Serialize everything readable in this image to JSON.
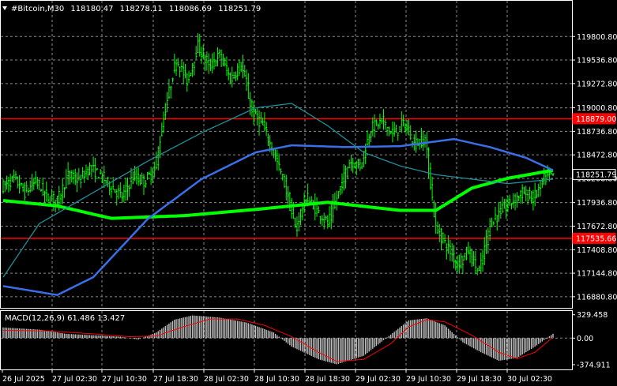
{
  "header": {
    "icon": "triangle-down-icon",
    "symbol": "#Bitcoin,M30",
    "open": "118180.47",
    "high": "118278.11",
    "low": "118086.69",
    "close": "118251.79"
  },
  "macd_label": "MACD(12,26,9) 61.486 13.427",
  "colors": {
    "background": "#000000",
    "candle": "#00ff00",
    "ma_slow": "#00ff00",
    "ma_blue": "#3a6fe8",
    "ma_teal": "#1f8f9a",
    "hline": "#ff0000",
    "macd_hist": "#c0c0c0",
    "macd_signal": "#ff0000",
    "grid": "#8a8a8a"
  },
  "chart_data": [
    {
      "type": "candlestick",
      "title": "#Bitcoin,M30",
      "ylim": [
        116800,
        120060
      ],
      "y_ticks": [
        "119800.80",
        "119536.80",
        "119272.80",
        "119000.80",
        "118736.80",
        "118472.80",
        "118208.80",
        "117936.80",
        "117672.80",
        "117408.80",
        "117144.80",
        "116880.80"
      ],
      "x_labels": [
        "26 Jul 2025",
        "27 Jul 02:30",
        "27 Jul 10:30",
        "27 Jul 18:30",
        "28 Jul 02:30",
        "28 Jul 10:30",
        "28 Jul 18:30",
        "29 Jul 02:30",
        "29 Jul 10:30",
        "29 Jul 18:30",
        "30 Jul 02:30"
      ],
      "grid": true,
      "price_tags": [
        {
          "label": "118879.00",
          "value": 118879.0,
          "type": "resistance",
          "color": "#ff0000"
        },
        {
          "label": "118251.79",
          "value": 118251.79,
          "type": "current",
          "color": "#000000"
        },
        {
          "label": "117535.66",
          "value": 117535.66,
          "type": "support",
          "color": "#ff0000"
        }
      ],
      "price_path": [
        [
          0,
          118120
        ],
        [
          6,
          118200
        ],
        [
          12,
          118050
        ],
        [
          18,
          118180
        ],
        [
          24,
          118000
        ],
        [
          30,
          117960
        ],
        [
          36,
          118240
        ],
        [
          42,
          118180
        ],
        [
          48,
          118330
        ],
        [
          54,
          118240
        ],
        [
          60,
          118110
        ],
        [
          66,
          118000
        ],
        [
          72,
          118230
        ],
        [
          78,
          118170
        ],
        [
          84,
          118300
        ],
        [
          90,
          119000
        ],
        [
          96,
          119550
        ],
        [
          102,
          119300
        ],
        [
          108,
          119700
        ],
        [
          114,
          119450
        ],
        [
          120,
          119600
        ],
        [
          126,
          119320
        ],
        [
          132,
          119500
        ],
        [
          138,
          118950
        ],
        [
          144,
          118800
        ],
        [
          150,
          118500
        ],
        [
          156,
          118150
        ],
        [
          162,
          117650
        ],
        [
          168,
          118000
        ],
        [
          174,
          117850
        ],
        [
          180,
          117700
        ],
        [
          186,
          118050
        ],
        [
          192,
          118400
        ],
        [
          198,
          118350
        ],
        [
          204,
          118780
        ],
        [
          210,
          118850
        ],
        [
          216,
          118700
        ],
        [
          222,
          118830
        ],
        [
          228,
          118600
        ],
        [
          234,
          118650
        ],
        [
          240,
          117650
        ],
        [
          246,
          117450
        ],
        [
          252,
          117250
        ],
        [
          258,
          117400
        ],
        [
          264,
          117150
        ],
        [
          270,
          117700
        ],
        [
          276,
          117850
        ],
        [
          282,
          117950
        ],
        [
          288,
          118050
        ],
        [
          294,
          117980
        ],
        [
          300,
          118200
        ],
        [
          305,
          118251.79
        ]
      ],
      "series": [
        {
          "name": "",
          "color": "#00ff00",
          "points": [
            [
              0,
              117960
            ],
            [
              30,
              117900
            ],
            [
              60,
              117760
            ],
            [
              100,
              117790
            ],
            [
              140,
              117860
            ],
            [
              180,
              117940
            ],
            [
              220,
              117850
            ],
            [
              240,
              117850
            ],
            [
              260,
              118100
            ],
            [
              280,
              118210
            ],
            [
              305,
              118300
            ]
          ]
        },
        {
          "name": "",
          "color": "#3a6fe8",
          "points": [
            [
              0,
              117000
            ],
            [
              30,
              116900
            ],
            [
              50,
              117100
            ],
            [
              80,
              117750
            ],
            [
              110,
              118200
            ],
            [
              140,
              118500
            ],
            [
              160,
              118580
            ],
            [
              190,
              118560
            ],
            [
              220,
              118570
            ],
            [
              250,
              118650
            ],
            [
              270,
              118560
            ],
            [
              290,
              118440
            ],
            [
              305,
              118300
            ]
          ]
        },
        {
          "name": "",
          "color": "#1f8f9a",
          "points": [
            [
              0,
              117100
            ],
            [
              20,
              117700
            ],
            [
              50,
              118050
            ],
            [
              80,
              118400
            ],
            [
              110,
              118720
            ],
            [
              140,
              119000
            ],
            [
              160,
              119050
            ],
            [
              180,
              118800
            ],
            [
              200,
              118500
            ],
            [
              220,
              118350
            ],
            [
              240,
              118250
            ],
            [
              260,
              118200
            ],
            [
              280,
              118150
            ],
            [
              305,
              118200
            ]
          ]
        }
      ]
    },
    {
      "type": "bar",
      "title": "MACD(12,26,9) 61.486 13.427",
      "ylim": [
        -420,
        360
      ],
      "y_ticks": [
        "329.458",
        "0.00",
        "-374.911"
      ],
      "grid": true,
      "series": [
        {
          "name": "MACD",
          "color": "#c0c0c0",
          "points": [
            [
              0,
              150
            ],
            [
              20,
              120
            ],
            [
              35,
              60
            ],
            [
              50,
              40
            ],
            [
              65,
              20
            ],
            [
              75,
              -20
            ],
            [
              85,
              80
            ],
            [
              95,
              260
            ],
            [
              105,
              320
            ],
            [
              120,
              290
            ],
            [
              135,
              220
            ],
            [
              150,
              80
            ],
            [
              160,
              -120
            ],
            [
              175,
              -300
            ],
            [
              185,
              -370
            ],
            [
              200,
              -250
            ],
            [
              215,
              50
            ],
            [
              225,
              250
            ],
            [
              235,
              280
            ],
            [
              245,
              180
            ],
            [
              255,
              -60
            ],
            [
              265,
              -200
            ],
            [
              275,
              -320
            ],
            [
              285,
              -280
            ],
            [
              295,
              -120
            ],
            [
              305,
              61.486
            ]
          ]
        },
        {
          "name": "Signal",
          "color": "#ff0000",
          "points": [
            [
              0,
              110
            ],
            [
              25,
              100
            ],
            [
              50,
              60
            ],
            [
              70,
              20
            ],
            [
              85,
              30
            ],
            [
              100,
              160
            ],
            [
              115,
              270
            ],
            [
              130,
              270
            ],
            [
              145,
              180
            ],
            [
              160,
              20
            ],
            [
              175,
              -200
            ],
            [
              185,
              -330
            ],
            [
              200,
              -300
            ],
            [
              215,
              -80
            ],
            [
              225,
              160
            ],
            [
              235,
              260
            ],
            [
              245,
              230
            ],
            [
              260,
              40
            ],
            [
              275,
              -200
            ],
            [
              285,
              -290
            ],
            [
              295,
              -200
            ],
            [
              305,
              13.427
            ]
          ]
        }
      ]
    }
  ]
}
